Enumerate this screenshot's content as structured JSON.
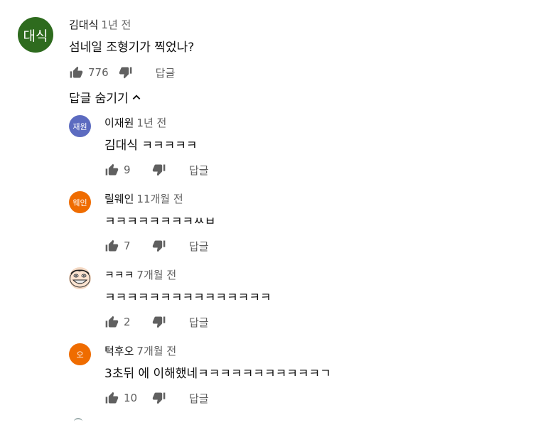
{
  "top_comment": {
    "avatar_text": "대식",
    "avatar_color": "#2e6b1e",
    "author": "김대식",
    "time": "1년 전",
    "text": "섬네일 조형기가 찍었나?",
    "likes": "776",
    "reply_label": "답글"
  },
  "toggle_label": "답글 숨기기",
  "replies": [
    {
      "avatar_text": "재원",
      "avatar_color": "#5c6bc0",
      "author": "이재원",
      "time": "1년 전",
      "text": "김대식 ㅋㅋㅋㅋㅋ",
      "likes": "9",
      "reply_label": "답글"
    },
    {
      "avatar_text": "웨인",
      "avatar_color": "#ef6c00",
      "author": "릴웨인",
      "time": "11개월 전",
      "text": "ㅋㅋㅋㅋㅋㅋㅋㅋㅆㅂ",
      "likes": "7",
      "reply_label": "답글"
    },
    {
      "avatar_text": "",
      "avatar_color": "#f4d9c4",
      "author": "ㅋㅋㅋ",
      "time": "7개월 전",
      "text": "ㅋㅋㅋㅋㅋㅋㅋㅋㅋㅋㅋㅋㅋㅋㅋ",
      "likes": "2",
      "reply_label": "답글"
    },
    {
      "avatar_text": "오",
      "avatar_color": "#ef6c00",
      "author": "턱후오",
      "time": "7개월 전",
      "text": "3초뒤 에 이해했네ㅋㅋㅋㅋㅋㅋㅋㅋㅋㅋㅋㄱ",
      "likes": "10",
      "reply_label": "답글"
    }
  ]
}
